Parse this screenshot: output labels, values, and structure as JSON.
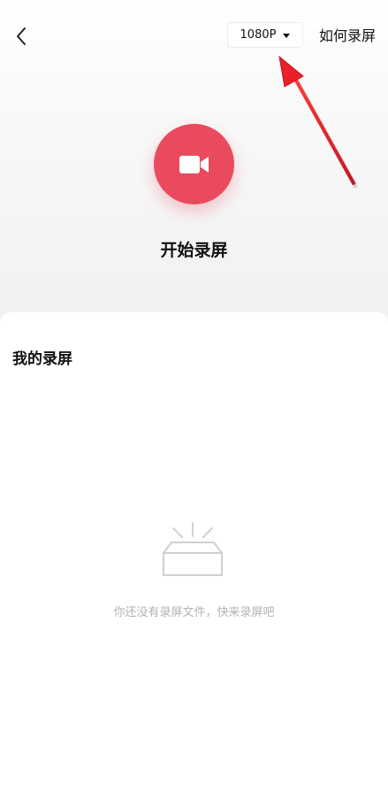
{
  "header": {
    "back_icon": "chevron-left-icon",
    "resolution": {
      "value": "1080P",
      "caret_icon": "caret-down-icon"
    },
    "help_link": "如何录屏"
  },
  "recorder": {
    "camera_icon": "video-camera-icon",
    "start_label": "开始录屏",
    "accent_color": "#ea4a5e"
  },
  "annotation": {
    "color": "#e8202a",
    "arrow_icon": "red-arrow-annotation"
  },
  "my_recordings": {
    "title": "我的录屏",
    "empty_icon": "empty-box-icon",
    "empty_text": "你还没有录屏文件，快来录屏吧"
  }
}
